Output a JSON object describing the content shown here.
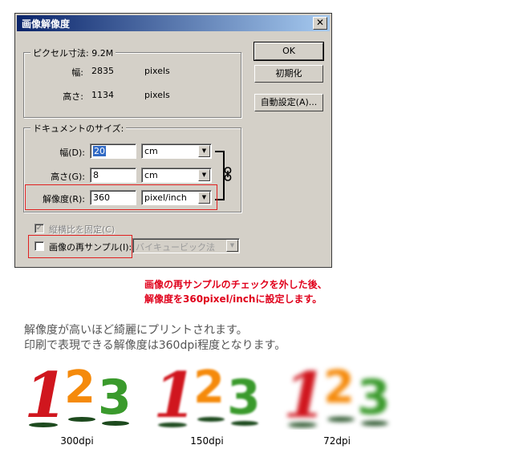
{
  "dialog": {
    "title": "画像解像度",
    "close_glyph": "✕",
    "pixel_group": {
      "label": "ピクセル寸法: 9.2M",
      "width_label": "幅:",
      "width_value": "2835",
      "width_unit": "pixels",
      "height_label": "高さ:",
      "height_value": "1134",
      "height_unit": "pixels"
    },
    "doc_group": {
      "label": "ドキュメントのサイズ:",
      "width_label": "幅(D):",
      "width_value": "20",
      "width_unit": "cm",
      "height_label": "高さ(G):",
      "height_value": "8",
      "height_unit": "cm",
      "resolution_label": "解像度(R):",
      "resolution_value": "360",
      "resolution_unit": "pixel/inch"
    },
    "constrain_label": "縦横比を固定(C)",
    "resample_label": "画像の再サンプル(I):",
    "resample_method": "バイキュービック法",
    "buttons": {
      "ok": "OK",
      "reset": "初期化",
      "auto": "自動設定(A)..."
    },
    "link_icon": "chain-link-icon"
  },
  "annotation": {
    "line1": "画像の再サンプルのチェックを外した後、",
    "line2": "解像度を360pixel/inchに設定します。"
  },
  "description": {
    "line1": "解像度が高いほど綺麗にプリントされます。",
    "line2": "印刷で表現できる解像度は360dpi程度となります。"
  },
  "samples": [
    {
      "digits": [
        "1",
        "2",
        "3"
      ],
      "label": "300dpi",
      "blur": 0
    },
    {
      "digits": [
        "1",
        "2",
        "3"
      ],
      "label": "150dpi",
      "blur": 1.2
    },
    {
      "digits": [
        "1",
        "2",
        "3"
      ],
      "label": "72dpi",
      "blur": 3
    }
  ],
  "colors": {
    "digit_1": "#d0161e",
    "digit_2": "#f58a0b",
    "digit_3": "#3a9a2c",
    "shadow": "#1d4a1e",
    "annotation": "#e0001b",
    "title_bar": "#0a246a"
  }
}
